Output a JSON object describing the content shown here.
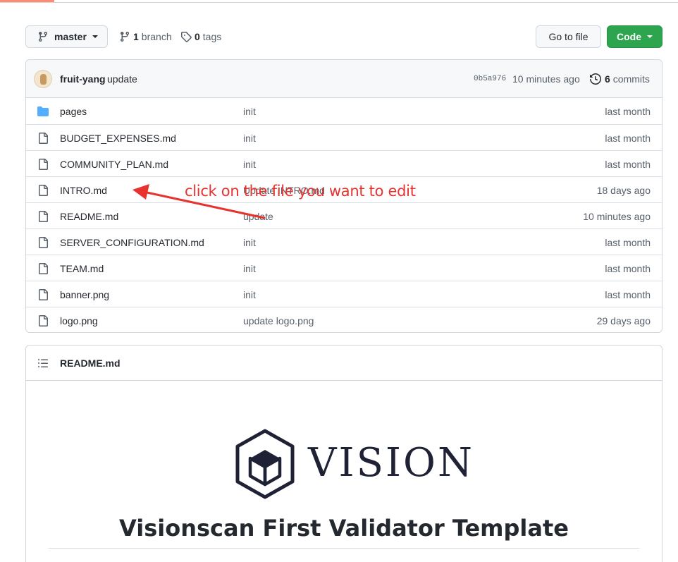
{
  "toolbar": {
    "branch_label": "master",
    "branches_count": "1",
    "branches_label": "branch",
    "tags_count": "0",
    "tags_label": "tags",
    "go_to_file_label": "Go to file",
    "code_label": "Code"
  },
  "commit": {
    "author": "fruit-yang",
    "message": "update",
    "sha": "0b5a976",
    "time": "10 minutes ago",
    "commits_count": "6",
    "commits_label": "commits"
  },
  "files": [
    {
      "name": "pages",
      "type": "folder",
      "message": "init",
      "age": "last month"
    },
    {
      "name": "BUDGET_EXPENSES.md",
      "type": "file",
      "message": "init",
      "age": "last month"
    },
    {
      "name": "COMMUNITY_PLAN.md",
      "type": "file",
      "message": "init",
      "age": "last month"
    },
    {
      "name": "INTRO.md",
      "type": "file",
      "message": "Update INTRO.md",
      "age": "18 days ago"
    },
    {
      "name": "README.md",
      "type": "file",
      "message": "update",
      "age": "10 minutes ago"
    },
    {
      "name": "SERVER_CONFIGURATION.md",
      "type": "file",
      "message": "init",
      "age": "last month"
    },
    {
      "name": "TEAM.md",
      "type": "file",
      "message": "init",
      "age": "last month"
    },
    {
      "name": "banner.png",
      "type": "file",
      "message": "init",
      "age": "last month"
    },
    {
      "name": "logo.png",
      "type": "file",
      "message": "update logo.png",
      "age": "29 days ago"
    }
  ],
  "annotation": {
    "text": "click on the file you want to edit",
    "color": "#e8322e"
  },
  "readme": {
    "title": "README.md",
    "logo_text": "VISION",
    "doc_title": "Visionscan First Validator Template"
  },
  "colors": {
    "accent_green": "#2da44e",
    "folder_blue": "#54aeff",
    "tab_underline": "#fd8c73"
  }
}
